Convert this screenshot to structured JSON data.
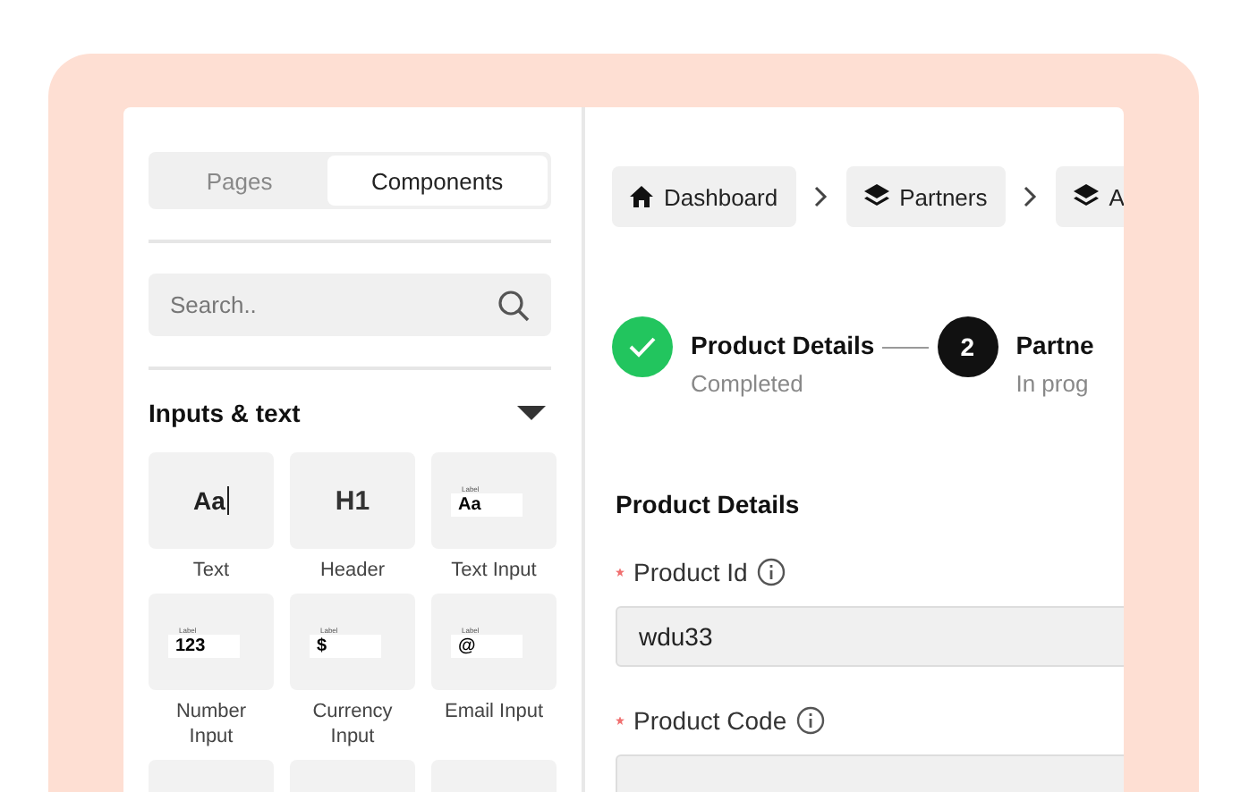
{
  "sidebar": {
    "tabs": [
      {
        "label": "Pages",
        "selected": false
      },
      {
        "label": "Components",
        "selected": true
      }
    ],
    "search": {
      "placeholder": "Search.."
    },
    "section": {
      "title": "Inputs & text",
      "expanded": true
    },
    "components": [
      {
        "kind": "text",
        "preview": "Aa",
        "label": "Text"
      },
      {
        "kind": "header",
        "preview": "H1",
        "label": "Header"
      },
      {
        "kind": "input",
        "caption": "Label",
        "preview": "Aa",
        "label": "Text Input"
      },
      {
        "kind": "input",
        "caption": "Label",
        "preview": "123",
        "label": "Number Input"
      },
      {
        "kind": "input",
        "caption": "Label",
        "preview": "$",
        "label": "Currency Input"
      },
      {
        "kind": "input",
        "caption": "Label",
        "preview": "@",
        "label": "Email Input"
      },
      {
        "kind": "partial"
      },
      {
        "kind": "partial"
      },
      {
        "kind": "partial"
      }
    ]
  },
  "breadcrumbs": [
    {
      "label": "Dashboard",
      "kind": "home"
    },
    {
      "label": "Partners",
      "kind": "layers"
    },
    {
      "label": "A",
      "kind": "layers"
    }
  ],
  "steps": [
    {
      "title": "Product Details",
      "status": "Completed",
      "completed": true
    },
    {
      "number": "2",
      "title": "Partne",
      "status": "In prog",
      "completed": false
    }
  ],
  "form": {
    "title": "Product Details",
    "fields": [
      {
        "label": "Product Id",
        "required": true,
        "value": "wdu33"
      },
      {
        "label": "Product Code",
        "required": true
      }
    ]
  }
}
